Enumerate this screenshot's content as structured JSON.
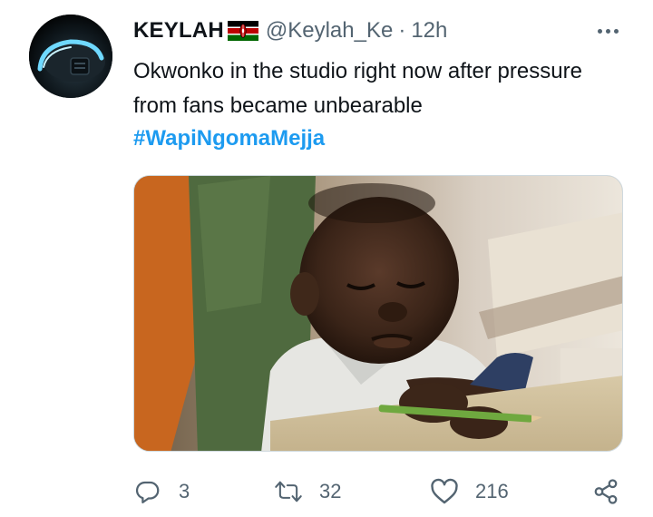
{
  "tweet": {
    "display_name": "KEYLAH",
    "flag_icon": "kenya-flag-icon",
    "handle": "@Keylah_Ke",
    "separator": "·",
    "time": "12h",
    "text": "Okwonko in the studio right now after pressure from fans became unbearable",
    "hashtag": "#WapiNgomaMejja",
    "accent_color": "#1d9bf0",
    "metrics": {
      "replies": "3",
      "retweets": "32",
      "likes": "216"
    },
    "icons": {
      "more": "more-horizontal-icon",
      "reply": "reply-icon",
      "retweet": "retweet-icon",
      "like": "heart-icon",
      "share": "share-icon"
    }
  }
}
